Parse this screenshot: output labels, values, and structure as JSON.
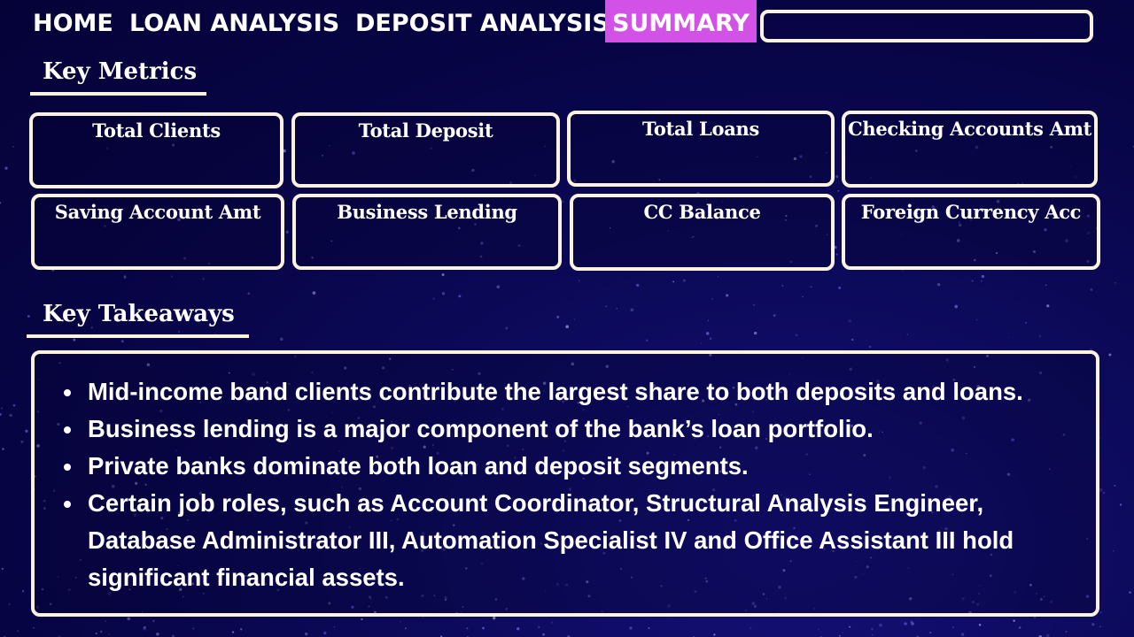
{
  "nav": {
    "home": "HOME",
    "loan_analysis": "LOAN ANALYSIS",
    "deposit_analysis": "DEPOSIT ANALYSIS",
    "summary": "SUMMARY",
    "active_color": "#d252e8"
  },
  "key_metrics": {
    "title": "Key Metrics",
    "cards": [
      "Total Clients",
      "Total Deposit",
      "Total Loans",
      "Checking Accounts Amt",
      "Saving Account Amt",
      "Business Lending",
      "CC Balance",
      "Foreign Currency Acc"
    ]
  },
  "key_takeaways": {
    "title": "Key Takeaways",
    "items": [
      "Mid-income band clients contribute the largest share to both deposits and loans.",
      "Business lending is a major component of the bank’s loan portfolio.",
      "Private banks dominate both loan and deposit segments.",
      "Certain job roles, such as Account Coordinator, Structural Analysis Engineer, Database Administrator III, Automation Specialist IV and Office Assistant III hold significant financial assets."
    ]
  },
  "colors": {
    "background": "#070444",
    "border": "#fbf3de",
    "accent": "#d252e8"
  }
}
